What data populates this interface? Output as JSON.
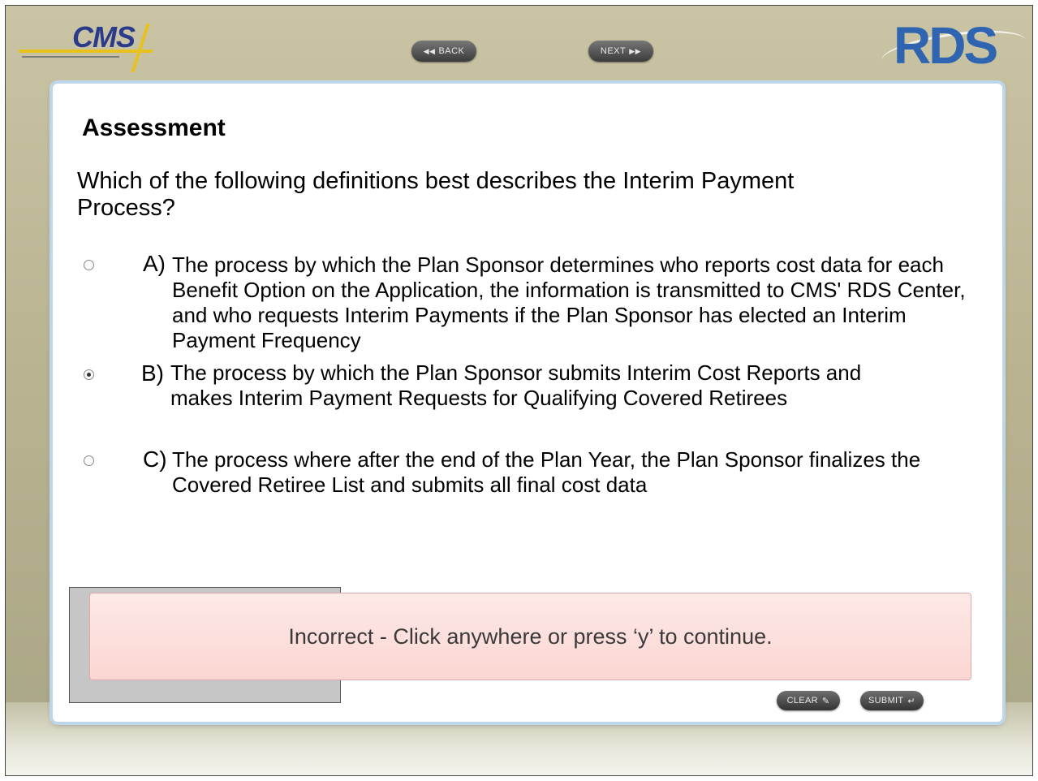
{
  "header": {
    "cms_logo": "CMS",
    "rds_logo": "RDS",
    "back_label": "BACK",
    "next_label": "NEXT",
    "back_icon": "rewind-icon",
    "next_icon": "fast-forward-icon"
  },
  "assessment": {
    "title": "Assessment",
    "question": "Which of the following definitions best describes the Interim Payment Process?",
    "options": [
      {
        "letter": "A)",
        "text": "The process by which the Plan Sponsor determines who reports cost data for each Benefit Option on the Application, the information is transmitted to CMS' RDS Center, and who requests Interim Payments if the Plan Sponsor has elected an Interim Payment Frequency",
        "selected": false
      },
      {
        "letter": "B)",
        "text": "The process by which the Plan Sponsor submits Interim Cost Reports and makes Interim Payment Requests for Qualifying Covered Retirees",
        "selected": true
      },
      {
        "letter": "C)",
        "text": "The process where after the end of the Plan Year, the Plan Sponsor finalizes the Covered Retiree List and submits all final cost data",
        "selected": false
      }
    ]
  },
  "feedback": {
    "message": "Incorrect - Click anywhere or press ‘y’ to continue.",
    "colors": {
      "background": "#fbd6d2",
      "border": "#e0a9a9"
    }
  },
  "actions": {
    "clear_label": "CLEAR",
    "submit_label": "SUBMIT",
    "clear_icon": "eraser-icon",
    "submit_icon": "enter-icon"
  },
  "colors": {
    "frame_bg": "#bfba98",
    "card_border": "#bdd6ea",
    "button_bg": "#3b3b3b"
  }
}
